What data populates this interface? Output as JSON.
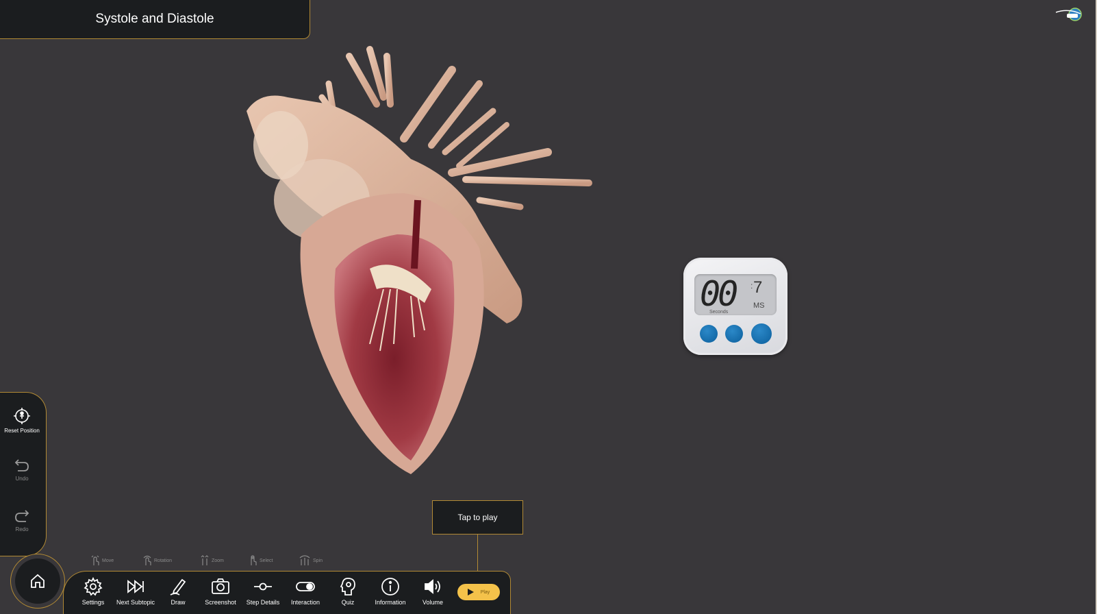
{
  "title": "Systole and Diastole",
  "timer": {
    "digits": "00",
    "separator": ":",
    "ms_value": "7",
    "ms_label": "MS",
    "seconds_label": "Seconds"
  },
  "tooltip": "Tap to play",
  "side_panel": {
    "reset_label": "Reset Position",
    "undo_label": "Undo",
    "redo_label": "Redo"
  },
  "hints": [
    {
      "label": "Move"
    },
    {
      "label": "Rotation"
    },
    {
      "label": "Zoom"
    },
    {
      "label": "Select"
    },
    {
      "label": "Spin"
    }
  ],
  "toolbar": {
    "settings": "Settings",
    "next_subtopic": "Next Subtopic",
    "draw": "Draw",
    "screenshot": "Screenshot",
    "step_details": "Step Details",
    "interaction": "Interaction",
    "quiz": "Quiz",
    "information": "Information",
    "volume": "Volume",
    "play": "Play"
  },
  "colors": {
    "panel": "#1b1d1f",
    "background": "#39373a",
    "accent_border": "#b28a34",
    "play_button": "#f4c24a",
    "timer_button": "#0c5f9c"
  }
}
